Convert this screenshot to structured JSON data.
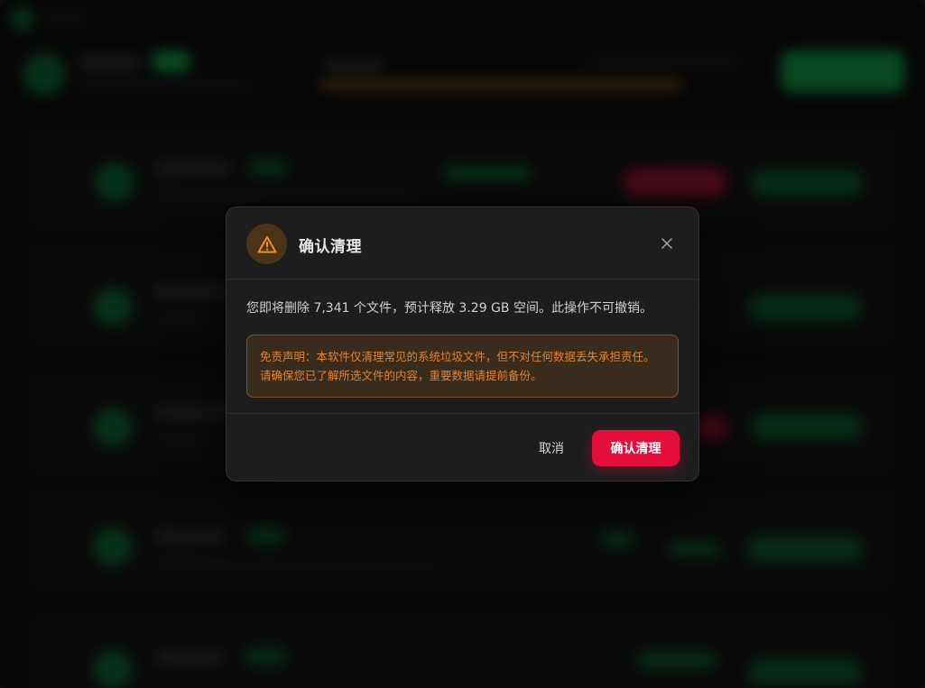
{
  "dialog": {
    "title": "确认清理",
    "icon": "warning-icon",
    "close_icon": "close-icon",
    "message": "您即将删除 7,341 个文件，预计释放 3.29 GB 空间。此操作不可撤销。",
    "disclaimer": "免责声明：本软件仅清理常见的系统垃圾文件，但不对任何数据丢失承担责任。请确保您已了解所选文件的内容，重要数据请提前备份。",
    "cancel_label": "取消",
    "confirm_label": "确认清理"
  },
  "colors": {
    "accent_danger": "#e50d3a",
    "warning": "#e6822a",
    "warning_bg": "#3a2c1c",
    "success": "#0f6b36",
    "modal_bg": "#1d1d1f"
  }
}
